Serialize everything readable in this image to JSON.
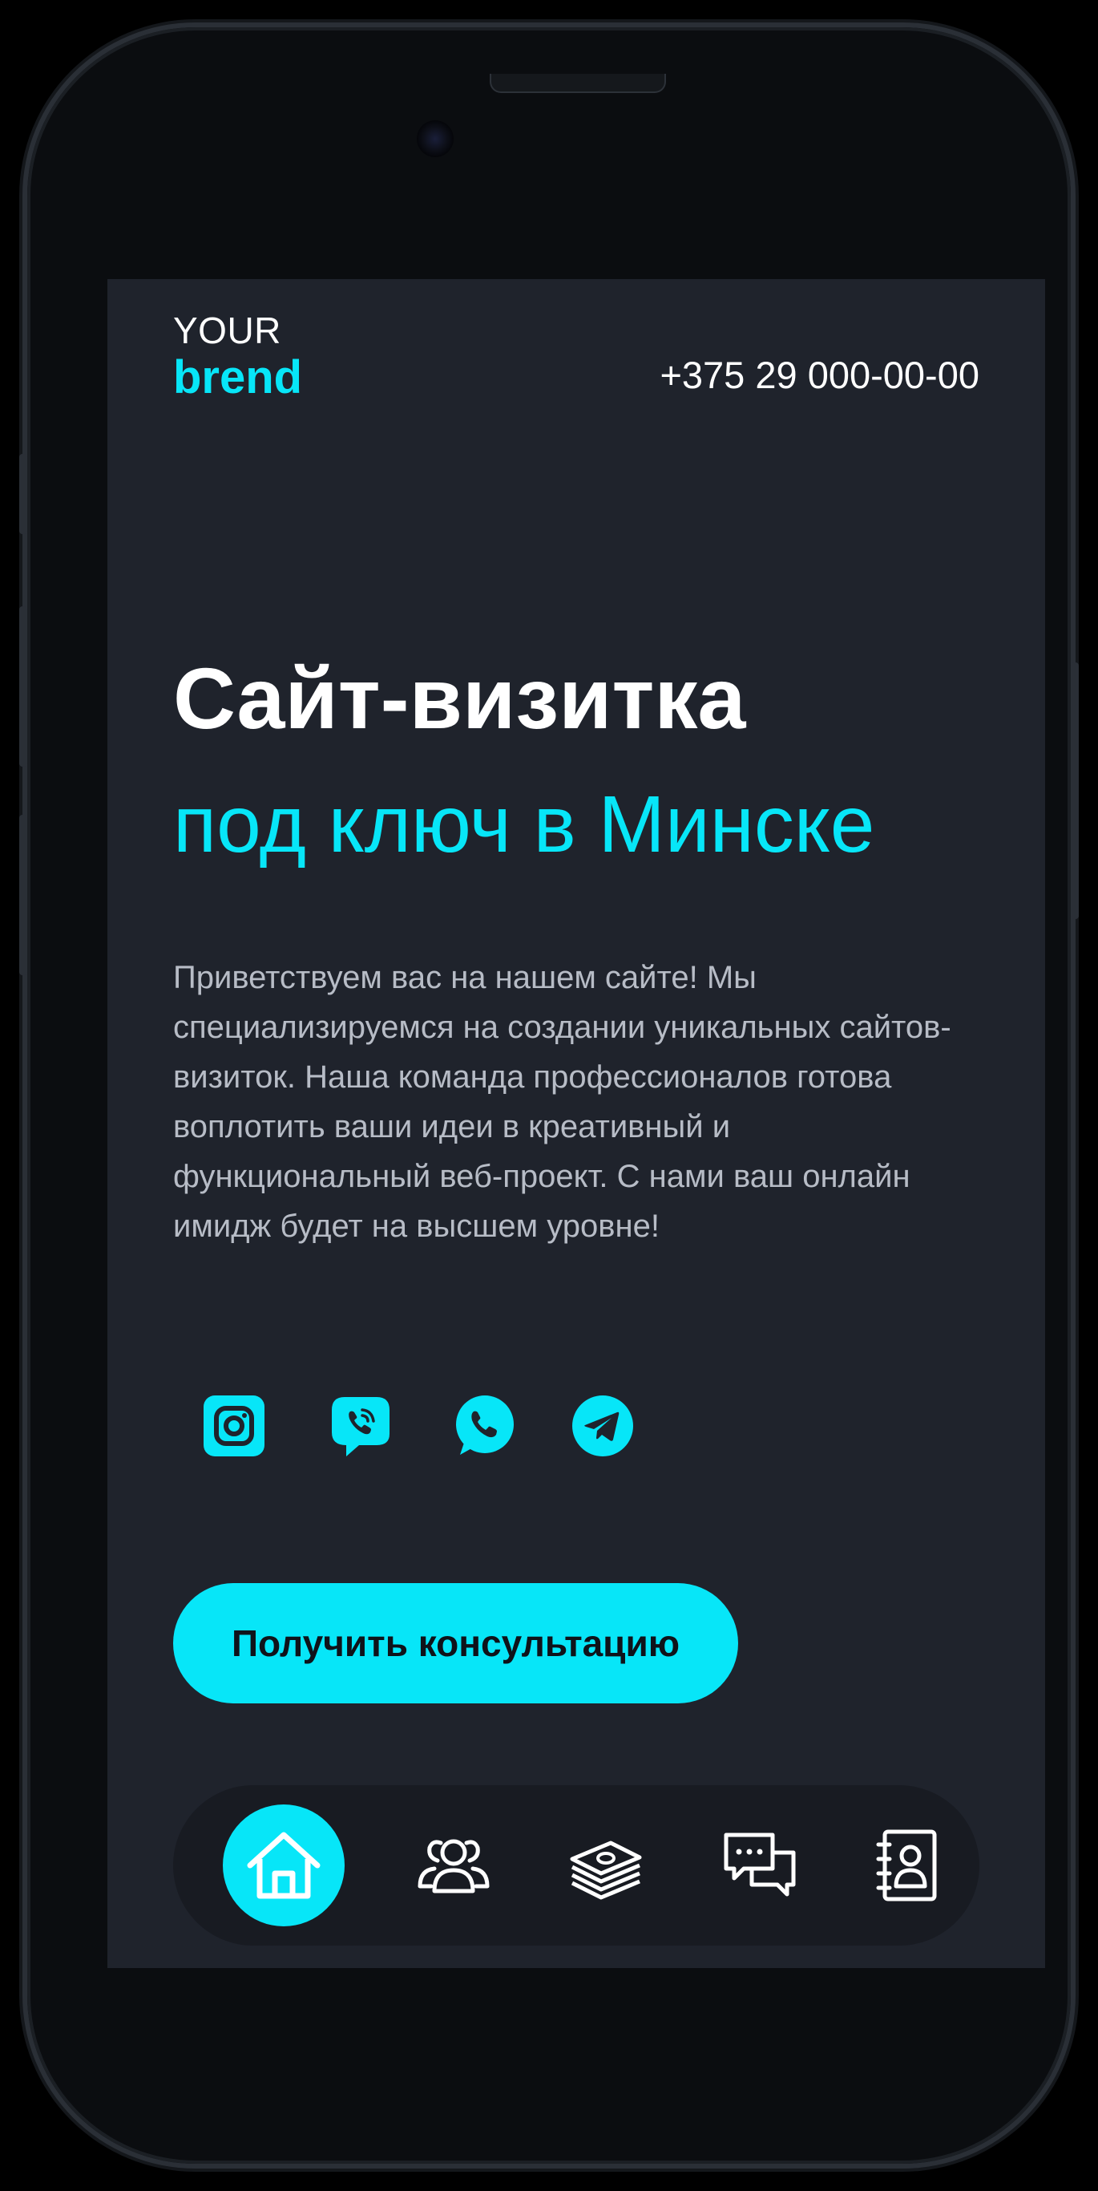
{
  "colors": {
    "accent": "#07e6f8",
    "background": "#1f232c",
    "nav_background": "#181b22",
    "text_primary": "#ffffff",
    "text_secondary": "#b7bcc6"
  },
  "header": {
    "logo_top": "YOUR",
    "logo_bottom": "brend",
    "phone": "+375 29 000-00-00"
  },
  "hero": {
    "title": "Сайт-визитка",
    "subtitle": "под ключ в Минске",
    "intro": "Приветствуем вас на нашем сайте! Мы специализируемся на создании уникальных сайтов-визиток. Наша команда профессионалов готова воплотить ваши идеи в креативный и функциональный веб-проект. С нами ваш онлайн имидж будет на высшем уровне!"
  },
  "socials": [
    {
      "icon": "instagram-icon"
    },
    {
      "icon": "viber-icon"
    },
    {
      "icon": "whatsapp-icon"
    },
    {
      "icon": "telegram-icon"
    }
  ],
  "cta": {
    "label": "Получить консультацию"
  },
  "nav": {
    "active_index": 0,
    "items": [
      {
        "icon": "home-icon"
      },
      {
        "icon": "team-icon"
      },
      {
        "icon": "money-icon"
      },
      {
        "icon": "chat-icon"
      },
      {
        "icon": "contacts-icon"
      }
    ]
  }
}
